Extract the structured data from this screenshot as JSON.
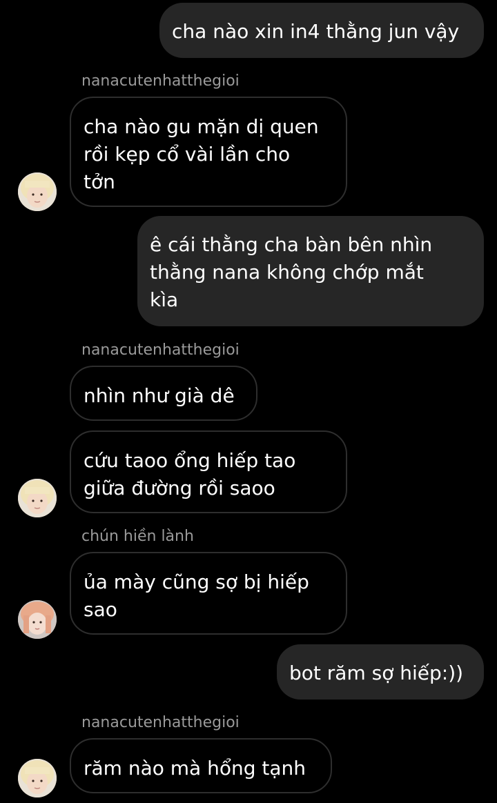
{
  "messages": [
    {
      "type": "outgoing",
      "text": "cha nào xin in4 thằng jun vậy"
    },
    {
      "type": "sender",
      "text": "nanacutenhatthegioi"
    },
    {
      "type": "incoming",
      "text": "cha nào gu mặn dị quen\nrồi kẹp cổ vài lần cho\ntởn"
    },
    {
      "type": "outgoing",
      "text": "ê cái thằng cha bàn bên nhìn\nthằng nana không chớp mắt\nkìa"
    },
    {
      "type": "sender",
      "text": "nanacutenhatthegioi"
    },
    {
      "type": "incoming",
      "text": "nhìn như già dê"
    },
    {
      "type": "incoming",
      "text": "cứu taoo ổng hiếp tao\ngiữa đường rồi saoo"
    },
    {
      "type": "sender",
      "text": "chún hiền lành"
    },
    {
      "type": "incoming",
      "text": "ủa mày cũng sợ bị hiếp\nsao"
    },
    {
      "type": "outgoing",
      "text": "bot răm sợ hiếp:))"
    },
    {
      "type": "sender",
      "text": "nanacutenhatthegioi"
    },
    {
      "type": "incoming",
      "text": "răm nào mà hổng tạnh"
    }
  ],
  "avatars": [
    {
      "icon": "user-avatar-nana"
    },
    {
      "icon": "user-avatar-nana"
    },
    {
      "icon": "user-avatar-chun"
    },
    {
      "icon": "user-avatar-nana"
    }
  ]
}
